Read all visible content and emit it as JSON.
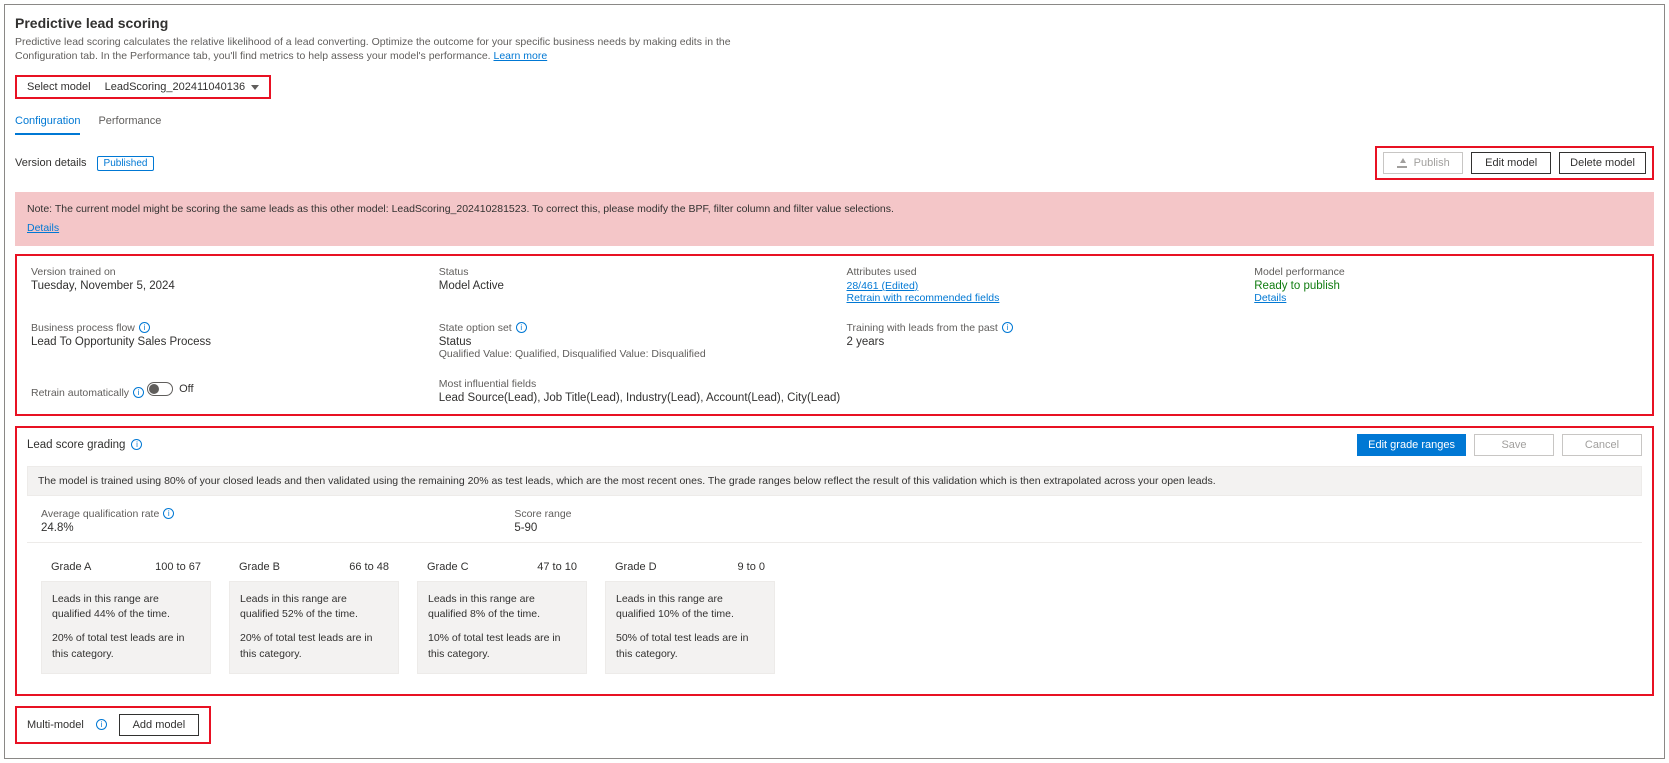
{
  "header": {
    "title": "Predictive lead scoring",
    "description": "Predictive lead scoring calculates the relative likelihood of a lead converting. Optimize the outcome for your specific business needs by making edits in the Configuration tab. In the Performance tab, you'll find metrics to help assess your model's performance.",
    "learn_more": "Learn more"
  },
  "model_select": {
    "label": "Select model",
    "value": "LeadScoring_202411040136"
  },
  "tabs": {
    "config": "Configuration",
    "perf": "Performance"
  },
  "version": {
    "label": "Version details",
    "badge": "Published",
    "publish_btn": "Publish",
    "edit_btn": "Edit model",
    "delete_btn": "Delete model"
  },
  "warning": {
    "text": "Note: The current model might be scoring the same leads as this other model: LeadScoring_202410281523. To correct this, please modify the BPF, filter column and filter value selections.",
    "details": "Details"
  },
  "info": {
    "trained_on_label": "Version trained on",
    "trained_on_value": "Tuesday, November 5, 2024",
    "status_label": "Status",
    "status_value": "Model Active",
    "attrs_label": "Attributes used",
    "attrs_value": "28/461 (Edited)",
    "attrs_link": "Retrain with recommended fields",
    "perf_label": "Model performance",
    "perf_value": "Ready to publish",
    "perf_link": "Details",
    "bpf_label": "Business process flow",
    "bpf_value": "Lead To Opportunity Sales Process",
    "state_label": "State option set",
    "state_value": "Status",
    "state_detail": "Qualified Value: Qualified, Disqualified Value: Disqualified",
    "train_past_label": "Training with leads from the past",
    "train_past_value": "2 years",
    "retrain_label": "Retrain automatically",
    "retrain_value": "Off",
    "influential_label": "Most influential fields",
    "influential_value": "Lead Source(Lead), Job Title(Lead), Industry(Lead), Account(Lead), City(Lead)"
  },
  "grading": {
    "title": "Lead score grading",
    "edit_btn": "Edit grade ranges",
    "save_btn": "Save",
    "cancel_btn": "Cancel",
    "note": "The model is trained using 80% of your closed leads and then validated using the remaining 20% as test leads, which are the most recent ones. The grade ranges below reflect the result of this validation which is then extrapolated across your open leads.",
    "avg_label": "Average qualification rate",
    "avg_value": "24.8%",
    "range_label": "Score range",
    "range_value": "5-90",
    "grades": [
      {
        "name": "Grade A",
        "range": "100 to 67",
        "line1": "Leads in this range are qualified 44% of the time.",
        "line2": "20% of total test leads are in this category."
      },
      {
        "name": "Grade B",
        "range": "66 to 48",
        "line1": "Leads in this range are qualified 52% of the time.",
        "line2": "20% of total test leads are in this category."
      },
      {
        "name": "Grade C",
        "range": "47 to 10",
        "line1": "Leads in this range are qualified 8% of the time.",
        "line2": "10% of total test leads are in this category."
      },
      {
        "name": "Grade D",
        "range": "9 to 0",
        "line1": "Leads in this range are qualified 10% of the time.",
        "line2": "50% of total test leads are in this category."
      }
    ]
  },
  "multi": {
    "label": "Multi-model",
    "add_btn": "Add model"
  }
}
